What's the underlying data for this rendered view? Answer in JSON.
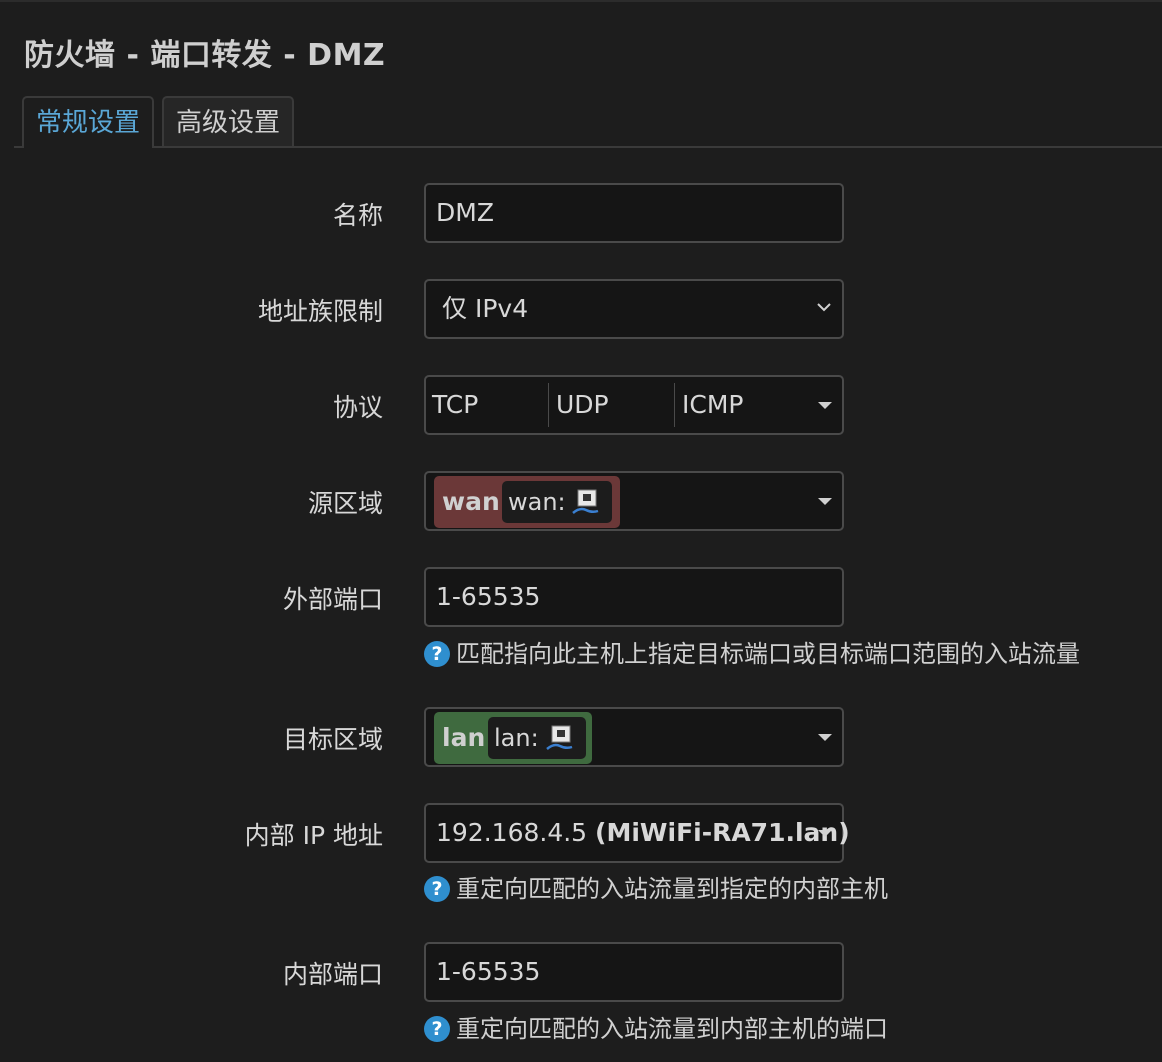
{
  "page_title": "防火墙 - 端口转发 - DMZ",
  "tabs": [
    {
      "label": "常规设置",
      "active": true
    },
    {
      "label": "高级设置",
      "active": false
    }
  ],
  "form": {
    "name": {
      "label": "名称",
      "value": "DMZ"
    },
    "family": {
      "label": "地址族限制",
      "value": "仅 IPv4"
    },
    "protocol": {
      "label": "协议",
      "values": [
        "TCP",
        "UDP",
        "ICMP"
      ]
    },
    "src_zone": {
      "label": "源区域",
      "zone": "wan",
      "iface": "wan:",
      "color": "#6b3838"
    },
    "src_port": {
      "label": "外部端口",
      "value": "1-65535",
      "hint": "匹配指向此主机上指定目标端口或目标端口范围的入站流量"
    },
    "dest_zone": {
      "label": "目标区域",
      "zone": "lan",
      "iface": "lan:",
      "color": "#3f6a3f"
    },
    "dest_ip": {
      "label": "内部 IP 地址",
      "ip": "192.168.4.5",
      "host": "(MiWiFi-RA71.lan)",
      "hint": "重定向匹配的入站流量到指定的内部主机"
    },
    "dest_port": {
      "label": "内部端口",
      "value": "1-65535",
      "hint": "重定向匹配的入站流量到内部主机的端口"
    }
  },
  "icons": {
    "help": "question-circle-icon",
    "network": "network-port-icon",
    "dropdown": "chevron-down-icon"
  },
  "colors": {
    "accent": "#5aa7d6",
    "help_icon": "#2f8fcf",
    "background": "#1d1d1d"
  }
}
